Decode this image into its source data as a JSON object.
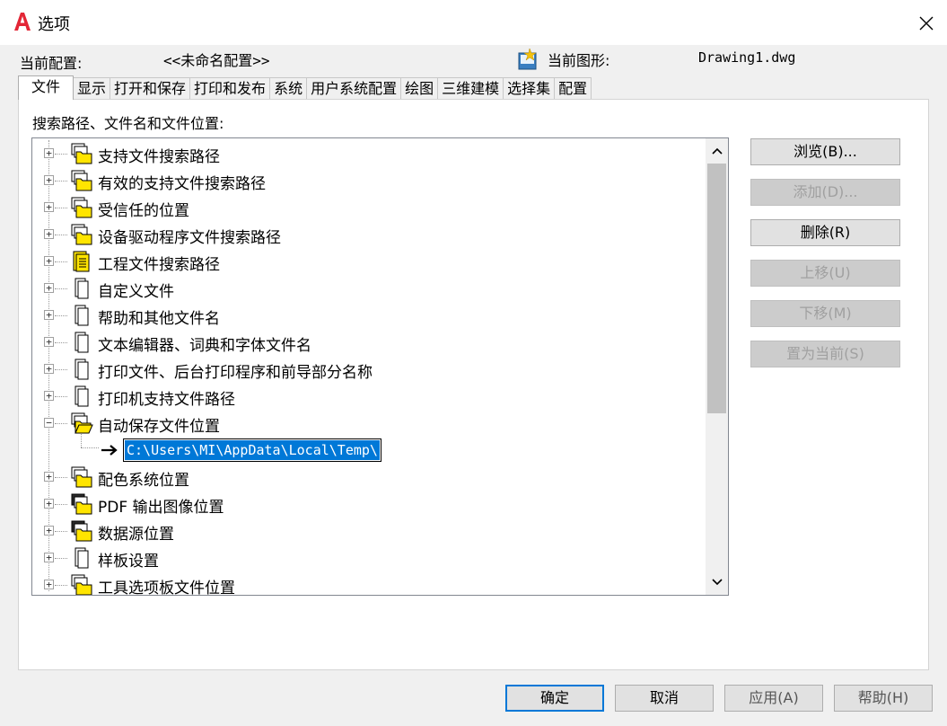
{
  "window": {
    "title": "选项",
    "close_glyph": "✕"
  },
  "header": {
    "profile_label": "当前配置:",
    "profile_value": "<<未命名配置>>",
    "drawing_label": "当前图形:",
    "drawing_value": "Drawing1.dwg"
  },
  "tabs": [
    {
      "label": "文件",
      "active": true
    },
    {
      "label": "显示"
    },
    {
      "label": "打开和保存"
    },
    {
      "label": "打印和发布"
    },
    {
      "label": "系统"
    },
    {
      "label": "用户系统配置"
    },
    {
      "label": "绘图"
    },
    {
      "label": "三维建模"
    },
    {
      "label": "选择集"
    },
    {
      "label": "配置"
    }
  ],
  "panel": {
    "search_label": "搜索路径、文件名和文件位置:"
  },
  "tree": {
    "items": [
      {
        "label": "支持文件搜索路径",
        "icon": "folder-stack-icon",
        "expanded": false
      },
      {
        "label": "有效的支持文件搜索路径",
        "icon": "folder-stack-icon",
        "expanded": false
      },
      {
        "label": "受信任的位置",
        "icon": "folder-stack-icon",
        "expanded": false
      },
      {
        "label": "设备驱动程序文件搜索路径",
        "icon": "folder-stack-icon",
        "expanded": false
      },
      {
        "label": "工程文件搜索路径",
        "icon": "project-file-icon",
        "expanded": false
      },
      {
        "label": "自定义文件",
        "icon": "document-icon",
        "expanded": false
      },
      {
        "label": "帮助和其他文件名",
        "icon": "document-icon",
        "expanded": false
      },
      {
        "label": "文本编辑器、词典和字体文件名",
        "icon": "document-icon",
        "expanded": false
      },
      {
        "label": "打印文件、后台打印程序和前导部分名称",
        "icon": "document-icon",
        "expanded": false
      },
      {
        "label": "打印机支持文件路径",
        "icon": "document-icon",
        "expanded": false
      },
      {
        "label": "自动保存文件位置",
        "icon": "open-folder-icon",
        "expanded": true
      },
      {
        "label": "配色系统位置",
        "icon": "folder-stack-icon",
        "expanded": false
      },
      {
        "label": "PDF 输出图像位置",
        "icon": "folder-stack-dark-icon",
        "expanded": false
      },
      {
        "label": "数据源位置",
        "icon": "folder-stack-dark-icon",
        "expanded": false
      },
      {
        "label": "样板设置",
        "icon": "document-icon",
        "expanded": false
      },
      {
        "label": "工具选项板文件位置",
        "icon": "folder-stack-icon",
        "expanded": false
      }
    ],
    "expanded_child": {
      "value": "C:\\Users\\MI\\AppData\\Local\\Temp\\",
      "icon": "arrow-right-icon"
    },
    "expand_glyph": "+",
    "collapse_glyph": "−"
  },
  "side_buttons": {
    "browse": "浏览(B)...",
    "add": "添加(D)...",
    "remove": "删除(R)",
    "move_up": "上移(U)",
    "move_down": "下移(M)",
    "set_current": "置为当前(S)"
  },
  "bottom_buttons": {
    "ok": "确定",
    "cancel": "取消",
    "apply": "应用(A)",
    "help": "帮助(H)"
  },
  "colors": {
    "accent": "#0078d7",
    "folder": "#ffe500",
    "app_logo": "#e32636"
  }
}
